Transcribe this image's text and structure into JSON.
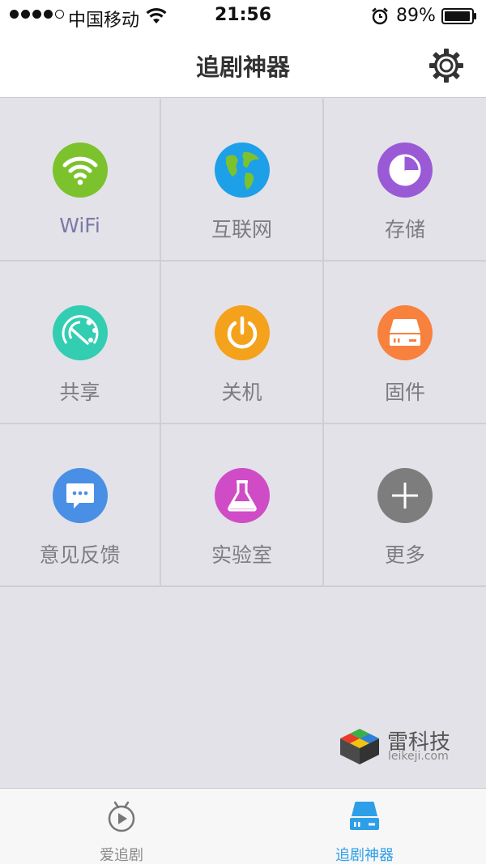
{
  "status_bar": {
    "carrier": "中国移动",
    "time": "21:56",
    "battery": "89%",
    "icons": [
      "signal-dots-icon",
      "wifi-icon",
      "alarm-icon",
      "battery-icon"
    ]
  },
  "nav": {
    "title": "追剧神器",
    "settings_icon": "gear-icon"
  },
  "grid": [
    {
      "label": "WiFi",
      "icon": "wifi-icon",
      "color": "#7cc22d"
    },
    {
      "label": "互联网",
      "icon": "globe-icon",
      "color": "#1ea0e8"
    },
    {
      "label": "存储",
      "icon": "pie-chart-icon",
      "color": "#9a5ad6"
    },
    {
      "label": "共享",
      "icon": "share-dial-icon",
      "color": "#33cdb2"
    },
    {
      "label": "关机",
      "icon": "power-icon",
      "color": "#f4a21b"
    },
    {
      "label": "固件",
      "icon": "hard-drive-icon",
      "color": "#f7813d"
    },
    {
      "label": "意见反馈",
      "icon": "chat-bubble-icon",
      "color": "#4a8fe6"
    },
    {
      "label": "实验室",
      "icon": "flask-icon",
      "color": "#d04cc6"
    },
    {
      "label": "更多",
      "icon": "plus-icon",
      "color": "#7d7d7d"
    }
  ],
  "watermark": {
    "name": "雷科技",
    "url": "leikeji.com"
  },
  "tabs": [
    {
      "label": "爱追剧",
      "icon": "tv-play-icon",
      "active": false
    },
    {
      "label": "追剧神器",
      "icon": "drive-icon",
      "active": true
    }
  ],
  "colors": {
    "accent": "#2d9fe8",
    "background": "#e3e2e8"
  }
}
